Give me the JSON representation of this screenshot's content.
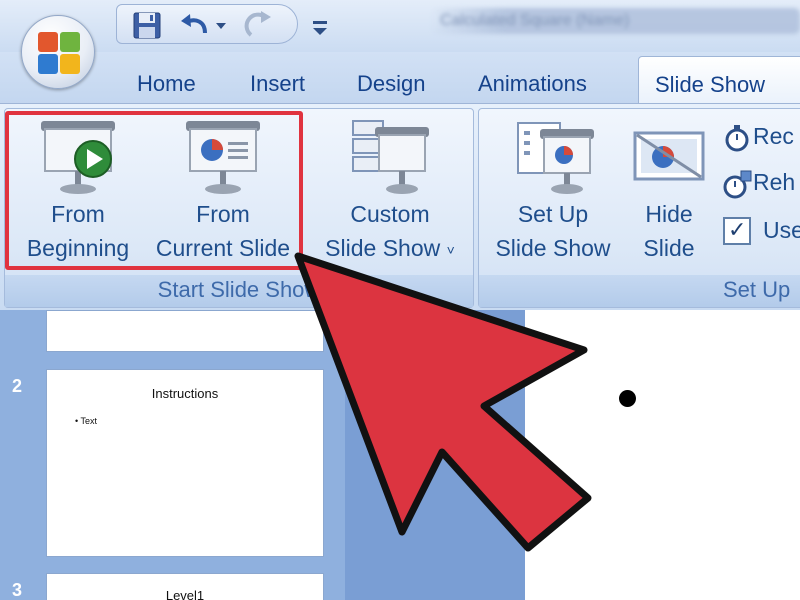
{
  "window": {
    "title": "Calculated Square (Name)"
  },
  "quick_access": {
    "icons": [
      "save-icon",
      "undo-icon",
      "undo-dropdown-icon",
      "redo-icon",
      "customize-icon"
    ]
  },
  "tabs": [
    {
      "label": "Home",
      "active": false
    },
    {
      "label": "Insert",
      "active": false
    },
    {
      "label": "Design",
      "active": false
    },
    {
      "label": "Animations",
      "active": false
    },
    {
      "label": "Slide Show",
      "active": true
    }
  ],
  "ribbon": {
    "start_group": {
      "label": "Start Slide Show",
      "from_beginning": {
        "line1": "From",
        "line2": "Beginning"
      },
      "from_current": {
        "line1": "From",
        "line2": "Current Slide"
      },
      "custom": {
        "line1": "Custom",
        "line2": "Slide Show",
        "dropdown": "˅"
      }
    },
    "setup_group": {
      "label": "Set Up",
      "setup": {
        "line1": "Set Up",
        "line2": "Slide Show"
      },
      "hide": {
        "line1": "Hide",
        "line2": "Slide"
      },
      "record": "Rec",
      "rehearse": "Reh",
      "use": "Use",
      "use_checked": true,
      "check_mark": "✓"
    }
  },
  "slides": [
    {
      "number": "",
      "title": "",
      "bullet": ""
    },
    {
      "number": "2",
      "title": "Instructions",
      "bullet": "• Text"
    },
    {
      "number": "3",
      "title": "Level1",
      "bullet": ""
    }
  ],
  "colors": {
    "highlight": "#e0333f",
    "arrow": "#dc3440",
    "tab_text": "#15428b"
  }
}
